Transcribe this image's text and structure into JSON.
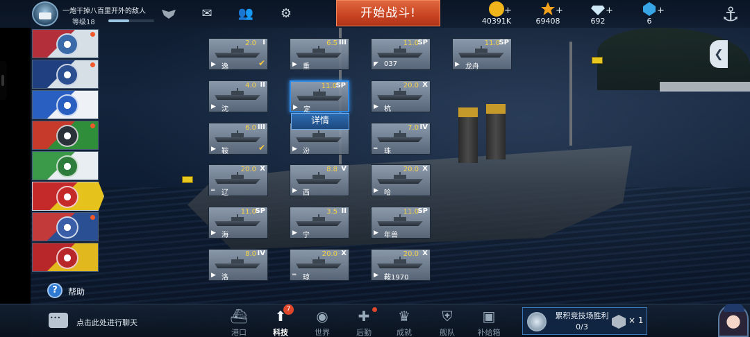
{
  "player": {
    "name": "一炮干掉八百里开外的敌人",
    "level": "等级18",
    "xp_fraction": 0.45
  },
  "top_icons": [
    "mail-icon",
    "friends-icon",
    "settings-gear-icon"
  ],
  "start_battle_label": "开始战斗!",
  "currencies": [
    {
      "name": "gold-coin-icon",
      "value": "40391K",
      "color": "#f1b51c"
    },
    {
      "name": "star-icon",
      "value": "69408",
      "color": "#f3a21d"
    },
    {
      "name": "diamond-icon",
      "value": "692",
      "color": "#cfe8f7"
    },
    {
      "name": "blue-gem-icon",
      "value": "6",
      "color": "#38a6e6"
    }
  ],
  "currency_plus": "+",
  "nations": [
    {
      "id": "japan",
      "bg": [
        "#b3303a",
        "#d6dfe6"
      ],
      "emblem": "#3b6aa8",
      "dot": true,
      "active": false
    },
    {
      "id": "usa",
      "bg": [
        "#1f3f80",
        "#d6dfe6"
      ],
      "emblem": "#2c4f92",
      "dot": true,
      "active": false
    },
    {
      "id": "france",
      "bg": [
        "#2a5fc2",
        "#eef2f6"
      ],
      "emblem": "#2a5fc2",
      "dot": false,
      "active": false
    },
    {
      "id": "germany",
      "bg": [
        "#c53a2a",
        "#2f8e3a"
      ],
      "emblem": "#2b3138",
      "dot": true,
      "active": false
    },
    {
      "id": "italy",
      "bg": [
        "#3a9a4a",
        "#e9eef2"
      ],
      "emblem": "#2f7d3c",
      "dot": false,
      "active": false
    },
    {
      "id": "china",
      "bg": [
        "#c52a2a",
        "#e6c21c"
      ],
      "emblem": "#c52a2a",
      "dot": false,
      "active": true
    },
    {
      "id": "uk",
      "bg": [
        "#c23a3a",
        "#2a4f92"
      ],
      "emblem": "#3a5ea8",
      "dot": true,
      "active": false
    },
    {
      "id": "soviet",
      "bg": [
        "#b8272a",
        "#e2b81f"
      ],
      "emblem": "#b8272a",
      "dot": false,
      "active": false
    }
  ],
  "help_label": "帮助",
  "detail_label": "详情",
  "ships": [
    {
      "name": "逸",
      "cost": "2.0",
      "tier": "I",
      "type": "▶",
      "owned": true
    },
    {
      "name": "重",
      "cost": "6.5",
      "tier": "III",
      "type": "▶",
      "owned": false
    },
    {
      "name": "037",
      "cost": "11.0",
      "tier": "SP",
      "type": "◤",
      "owned": false
    },
    {
      "name": "龙舟",
      "cost": "11.0",
      "tier": "SP",
      "type": "▶",
      "owned": false
    },
    {
      "name": "沈",
      "cost": "4.0",
      "tier": "II",
      "type": "▶",
      "owned": false
    },
    {
      "name": "定",
      "cost": "11.0",
      "tier": "SP",
      "type": "▶",
      "owned": false,
      "selected": true
    },
    {
      "name": "杭",
      "cost": "20.0",
      "tier": "X",
      "type": "▶",
      "owned": false
    },
    {
      "name": "鞍",
      "cost": "6.0",
      "tier": "III",
      "type": "▶",
      "owned": true
    },
    {
      "name": "汾",
      "cost": "8.0",
      "tier": "",
      "type": "▶",
      "owned": false
    },
    {
      "name": "珠",
      "cost": "7.0",
      "tier": "IV",
      "type": "═",
      "owned": false
    },
    {
      "name": "辽",
      "cost": "20.0",
      "tier": "X",
      "type": "═",
      "owned": false
    },
    {
      "name": "西",
      "cost": "8.8",
      "tier": "V",
      "type": "▶",
      "owned": false
    },
    {
      "name": "哈",
      "cost": "20.0",
      "tier": "X",
      "type": "▶",
      "owned": false
    },
    {
      "name": "海",
      "cost": "11.0",
      "tier": "SP",
      "type": "▶",
      "owned": false
    },
    {
      "name": "宁",
      "cost": "3.5",
      "tier": "II",
      "type": "▶",
      "owned": false
    },
    {
      "name": "年兽",
      "cost": "11.0",
      "tier": "SP",
      "type": "▶",
      "owned": false
    },
    {
      "name": "洛",
      "cost": "8.0",
      "tier": "IV",
      "type": "▶",
      "owned": false
    },
    {
      "name": "琼",
      "cost": "20.0",
      "tier": "X",
      "type": "═",
      "owned": false
    },
    {
      "name": "鞍1970",
      "cost": "20.0",
      "tier": "X",
      "type": "▶",
      "owned": false
    }
  ],
  "chat_label": "点击此处进行聊天",
  "nav": [
    {
      "id": "port",
      "label": "港口",
      "icon": "⛴",
      "active": false,
      "badge": "",
      "dot": false
    },
    {
      "id": "tech",
      "label": "科技",
      "icon": "⬆",
      "active": true,
      "badge": "7",
      "dot": false
    },
    {
      "id": "world",
      "label": "世界",
      "icon": "◉",
      "active": false,
      "badge": "",
      "dot": false
    },
    {
      "id": "crew",
      "label": "后勤",
      "icon": "✚",
      "active": false,
      "badge": "",
      "dot": true
    },
    {
      "id": "achieve",
      "label": "成就",
      "icon": "♛",
      "active": false,
      "badge": "",
      "dot": false
    },
    {
      "id": "fleet",
      "label": "舰队",
      "icon": "⛨",
      "active": false,
      "badge": "",
      "dot": false
    },
    {
      "id": "supply",
      "label": "补给箱",
      "icon": "▣",
      "active": false,
      "badge": "",
      "dot": false
    }
  ],
  "arena": {
    "title": "累积竞技场胜利",
    "progress": "0/3",
    "reward_multiplier": "× 1"
  },
  "colors": {
    "accent": "#2f8be6",
    "battle": "#d0502c",
    "cost": "#f6d14a"
  }
}
